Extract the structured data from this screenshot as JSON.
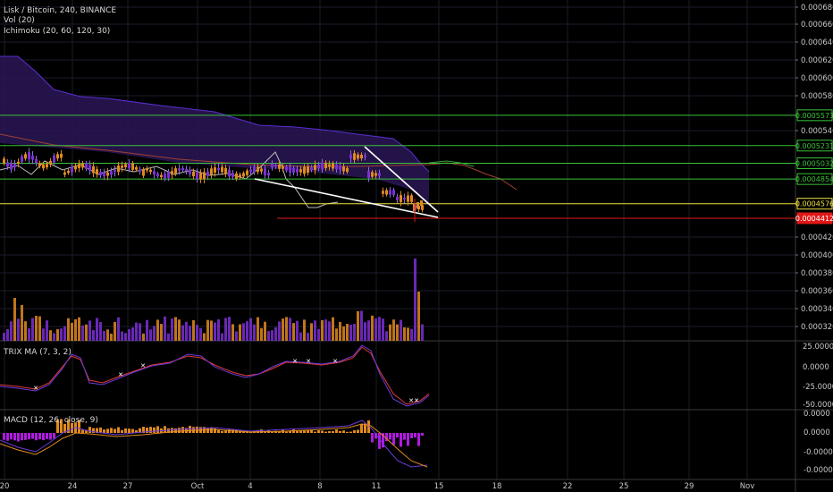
{
  "legend": {
    "title": "Lisk / Bitcoin, 240, BINANCE",
    "vol": "Vol (20)",
    "ichimoku": "Ichimoku (20, 60, 120, 30)",
    "trix": "TRIX MA (7, 3, 2)",
    "macd": "MACD (12, 26, close, 9)"
  },
  "colors": {
    "green": "#39c239",
    "yellow": "#f0e040",
    "red": "#e01818",
    "orange": "#e08a1e",
    "purple": "#7b2fd6",
    "white": "#ffffff",
    "grid": "#1c1c2c"
  },
  "chart_data": [
    {
      "type": "candlestick",
      "panel": "price",
      "symbol": "Lisk / Bitcoin",
      "interval": "240",
      "exchange": "BINANCE",
      "y_ticks": [
        "0.0006800",
        "0.0006600",
        "0.0006400",
        "0.0006200",
        "0.0006000",
        "0.0005800",
        "0.0005400",
        "0.0004200",
        "0.0004000",
        "0.0003800",
        "0.0003600",
        "0.0003400",
        "0.0003200"
      ],
      "x_ticks": [
        "20",
        "24",
        "27",
        "Oct",
        "4",
        "8",
        "11",
        "15",
        "18",
        "22",
        "25",
        "29",
        "Nov"
      ],
      "price_lines": [
        {
          "label": "0.0005573",
          "value": 0.0005573,
          "color": "green"
        },
        {
          "label": "0.0005231",
          "value": 0.0005231,
          "color": "green"
        },
        {
          "label": "0.0005032",
          "value": 0.0005032,
          "color": "green"
        },
        {
          "label": "0.0004854",
          "value": 0.0004854,
          "color": "green"
        },
        {
          "label": "0.0004576",
          "value": 0.0004576,
          "color": "yellow"
        },
        {
          "label": "0.0004412",
          "value": 0.0004412,
          "color": "red"
        }
      ],
      "grid": true
    },
    {
      "type": "bar",
      "panel": "volume",
      "name": "Vol (20)"
    },
    {
      "type": "line",
      "panel": "trix",
      "name": "TRIX MA (7, 3, 2)",
      "y_ticks": [
        "25.0000",
        "0.0000",
        "-25.0000",
        "-50.0000"
      ]
    },
    {
      "type": "bar",
      "panel": "macd",
      "name": "MACD (12, 26, close, 9)",
      "y_ticks": [
        "0.0000",
        "0.0000",
        "-0.0000",
        "-0.0000"
      ]
    }
  ]
}
